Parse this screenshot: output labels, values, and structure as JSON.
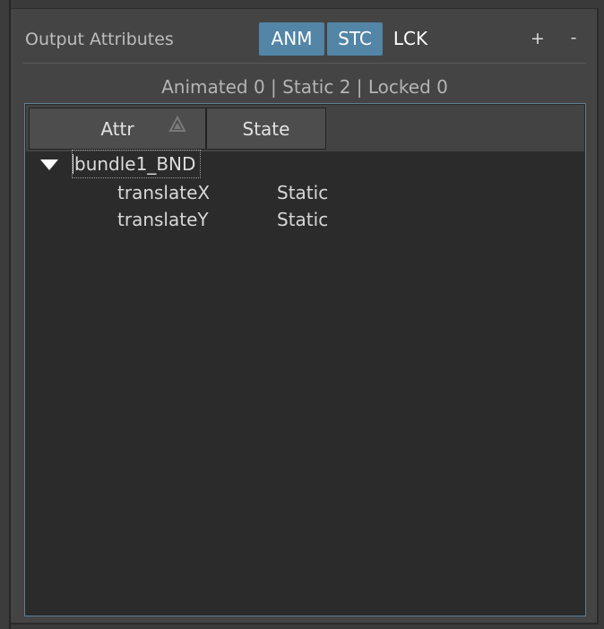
{
  "panel": {
    "title": "Output Attributes",
    "filters": [
      {
        "label": "ANM",
        "active": true
      },
      {
        "label": "STC",
        "active": true
      },
      {
        "label": "LCK",
        "active": false
      }
    ],
    "add_label": "+",
    "remove_label": "-",
    "summary": "Animated 0 | Static 2 | Locked 0"
  },
  "table": {
    "columns": [
      {
        "label": "Attr",
        "sort_icon": "sort-ascending-icon"
      },
      {
        "label": "State"
      }
    ],
    "parent": {
      "label": "bundle1_BND",
      "expanded": true
    },
    "rows": [
      {
        "attr": "translateX",
        "state": "Static"
      },
      {
        "attr": "translateY",
        "state": "Static"
      }
    ]
  },
  "colors": {
    "accent": "#5285a6",
    "background": "#444444",
    "table_bg": "#2b2b2b"
  }
}
